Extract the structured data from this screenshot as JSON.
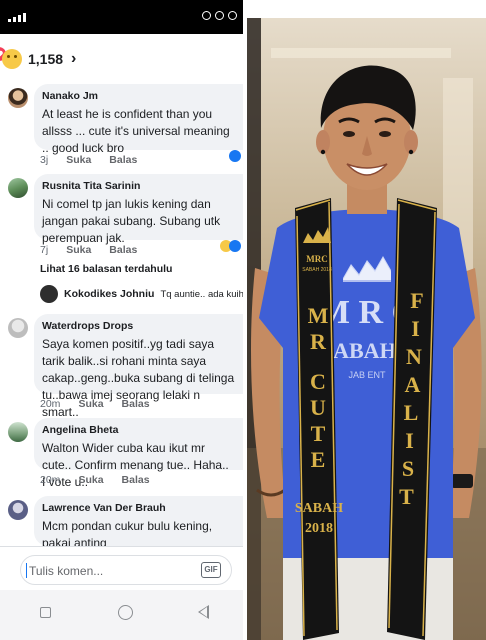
{
  "reactions": {
    "count": "1,158",
    "chevron": "›"
  },
  "comments": [
    {
      "author": "Nanako Jm",
      "text": "At least he is confident than you allsss ... cute it's universal meaning .. good luck bro",
      "time": "3j",
      "like": "Suka",
      "reply": "Balas"
    },
    {
      "author": "Rusnita Tita Sarinin",
      "text": "Ni comel tp jan lukis kening dan jangan pakai subang. Subang utk perempuan jak.",
      "time": "7j",
      "like": "Suka",
      "reply": "Balas"
    },
    {
      "author": "Waterdrops Drops",
      "text": "Saya komen positif..yg tadi saya tarik balik..si rohani minta saya cakap..geng..buka subang di telinga tu..bawa imej seorang lelaki n smart..",
      "time": "20m",
      "like": "Suka",
      "reply": "Balas"
    },
    {
      "author": "Angelina Bheta",
      "text": "Walton Wider cuba kau ikut mr cute.. Confirm menang tue.. Haha.. I vote u..",
      "time": "20m",
      "like": "Suka",
      "reply": "Balas"
    },
    {
      "author": "Lawrence Van Der Brauh",
      "text": "Mcm pondan cukur bulu kening, pakai anting"
    }
  ],
  "previous_replies": "Lihat 16 balasan terdahulu",
  "reply_preview": {
    "author": "Kokodikes Johniu",
    "text": "Tq auntie.. ada kuih le"
  },
  "composer": {
    "placeholder": "Tulis komen...",
    "gif_label": "GIF"
  },
  "photo": {
    "sash_left_badge_1": "MRC",
    "sash_left_badge_2": "SABAH 2018",
    "sash_left_text": [
      "M",
      "R",
      "",
      "C",
      "U",
      "T",
      "E"
    ],
    "sash_left_bottom_1": "SABAH",
    "sash_left_bottom_2": "2018",
    "sash_right_text": [
      "F",
      "I",
      "N",
      "A",
      "L",
      "I",
      "S",
      "T"
    ],
    "shirt_text_1": "M R C",
    "shirt_text_2": "SABAH 2",
    "shirt_text_3": "JAB ENT"
  },
  "colors": {
    "bubble": "#f0f2f5",
    "shirt": "#3f5fd6",
    "sash": "#141414",
    "sash_gold": "#d9b24a"
  }
}
